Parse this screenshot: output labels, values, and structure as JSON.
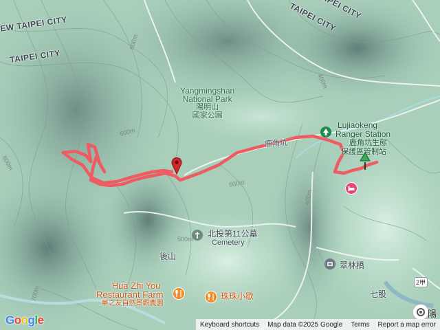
{
  "labels": {
    "city_top_left": "EW TAIPEI CITY",
    "city_left": "TAIPEI CITY",
    "city_top_right_1": "TAIPEI CITY",
    "city_top_right_2": "TAIPEI CITY",
    "park_en_1": "Yangmingshan",
    "park_en_2": "National Park",
    "park_zh_1": "陽明山",
    "park_zh_2": "國家公園",
    "station_en_1": "Lujiaokeng",
    "station_en_2": "Ranger Station",
    "station_zh_1": "鹿角坑生態",
    "station_zh_2": "保護區管制站",
    "cemetery_zh": "北投第11公墓",
    "cemetery_en": "Cemetery",
    "houshan": "後山",
    "cuilin": "翠林橋",
    "qigu": "七股",
    "farm_en_1": "Hua Zhi You",
    "farm_en_2": "Restaurant Farm",
    "farm_zh": "華之友自然景觀農園",
    "zhuzhu": "珠珠小歇",
    "road_label": "鹿角坑",
    "road_shield": "2甲",
    "corner_partial": "陽"
  },
  "contours": {
    "c800_top": "800m",
    "c600": "600m",
    "c800_left": "800m",
    "c500_mid": "500m",
    "c400_right": "400m",
    "c400_top": "400m",
    "c500_lower": "500m",
    "c700": "700m"
  },
  "footer": {
    "keyboard": "Keyboard shortcuts",
    "mapdata": "Map data ©2025 Google",
    "terms": "Terms",
    "report": "Report a map error"
  },
  "branding": {
    "google": "Google"
  },
  "colors": {
    "track": "#ef5b62",
    "start_marker": "#3cae55",
    "end_marker": "#d2262b",
    "station_icon": "#1e8b4c",
    "hotel_icon": "#e8437a",
    "food_icon": "#f28c28"
  }
}
